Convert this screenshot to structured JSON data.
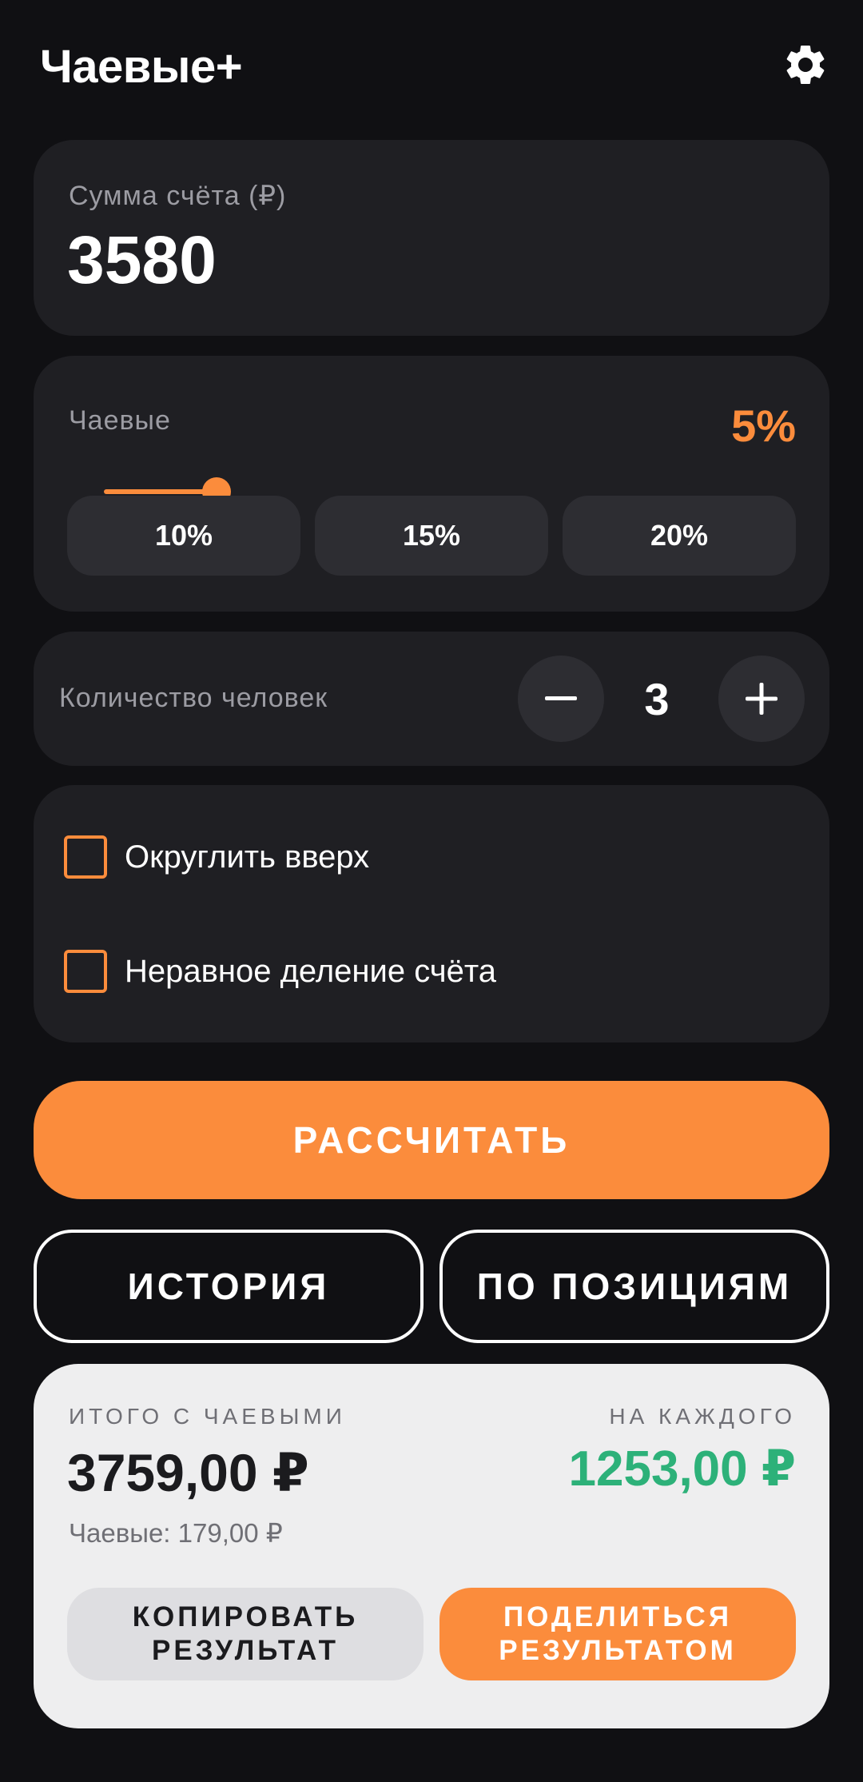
{
  "header": {
    "title": "Чаевые+",
    "settings_icon": "gear-icon"
  },
  "bill": {
    "label": "Сумма счёта (₽)",
    "value": "3580"
  },
  "tip": {
    "label": "Чаевые",
    "value": "5%",
    "slider_percent": 5,
    "presets": [
      "10%",
      "15%",
      "20%"
    ]
  },
  "people": {
    "label": "Количество человек",
    "count": "3",
    "minus_icon": "minus-icon",
    "plus_icon": "plus-icon"
  },
  "options": {
    "round_up": {
      "label": "Округлить вверх",
      "checked": false
    },
    "unequal_split": {
      "label": "Неравное деление счёта",
      "checked": false
    }
  },
  "actions": {
    "calculate": "РАССЧИТАТЬ",
    "history": "ИСТОРИЯ",
    "by_positions": "ПО ПОЗИЦИЯМ"
  },
  "result": {
    "total_label": "ИТОГО С ЧАЕВЫМИ",
    "total_value": "3759,00 ₽",
    "tip_amount": "Чаевые: 179,00 ₽",
    "each_label": "НА КАЖДОГО",
    "each_value": "1253,00 ₽",
    "copy_line1": "КОПИРОВАТЬ",
    "copy_line2": "РЕЗУЛЬТАТ",
    "share_line1": "ПОДЕЛИТЬСЯ",
    "share_line2": "РЕЗУЛЬТАТОМ"
  },
  "colors": {
    "accent": "#fb8c3c",
    "background": "#101013",
    "card": "#1f1f23",
    "success": "#2db179"
  }
}
